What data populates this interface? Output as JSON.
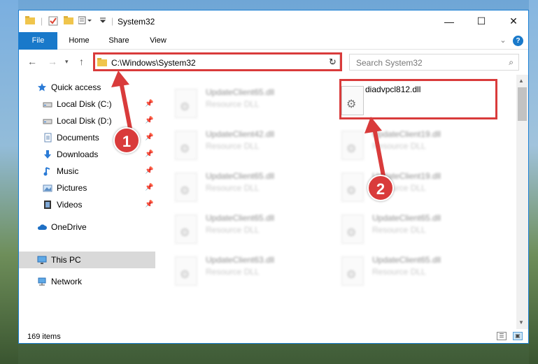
{
  "window": {
    "title": "System32",
    "controls": {
      "minimize": "—",
      "maximize": "☐",
      "close": "✕"
    }
  },
  "ribbon": {
    "tabs": [
      "File",
      "Home",
      "Share",
      "View"
    ],
    "help_icon": "?"
  },
  "address_bar": {
    "path": "C:\\Windows\\System32",
    "search_placeholder": "Search System32"
  },
  "sidebar": {
    "items": [
      {
        "label": "Quick access",
        "icon": "star-icon"
      },
      {
        "label": "Local Disk (C:)",
        "icon": "drive-icon",
        "pinned": true
      },
      {
        "label": "Local Disk (D:)",
        "icon": "drive-icon",
        "pinned": true
      },
      {
        "label": "Documents",
        "icon": "documents-icon",
        "pinned": true
      },
      {
        "label": "Downloads",
        "icon": "download-icon",
        "pinned": true
      },
      {
        "label": "Music",
        "icon": "music-icon",
        "pinned": true
      },
      {
        "label": "Pictures",
        "icon": "pictures-icon",
        "pinned": true
      },
      {
        "label": "Videos",
        "icon": "videos-icon",
        "pinned": true
      },
      {
        "label": "OneDrive",
        "icon": "cloud-icon"
      },
      {
        "label": "This PC",
        "icon": "computer-icon",
        "selected": true
      },
      {
        "label": "Network",
        "icon": "network-icon"
      }
    ]
  },
  "files": [
    {
      "name": "UpdateClient65.dll",
      "type": "Resource DLL"
    },
    {
      "name": "diadvpcl812.dll",
      "type": ""
    },
    {
      "name": "UpdateClient42.dll",
      "type": "Resource DLL"
    },
    {
      "name": "UpdateClient19.dll",
      "type": "Resource DLL"
    },
    {
      "name": "UpdateClient65.dll",
      "type": "Resource DLL"
    },
    {
      "name": "UpdateClient19.dll",
      "type": "Resource DLL"
    },
    {
      "name": "UpdateClient65.dll",
      "type": "Resource DLL"
    },
    {
      "name": "UpdateClient65.dll",
      "type": "Resource DLL"
    },
    {
      "name": "UpdateClient63.dll",
      "type": "Resource DLL"
    },
    {
      "name": "UpdateClient65.dll",
      "type": "Resource DLL"
    }
  ],
  "status_bar": {
    "item_count": "169 items"
  },
  "annotations": {
    "marker1": "1",
    "marker2": "2",
    "color": "#d93b3b"
  }
}
